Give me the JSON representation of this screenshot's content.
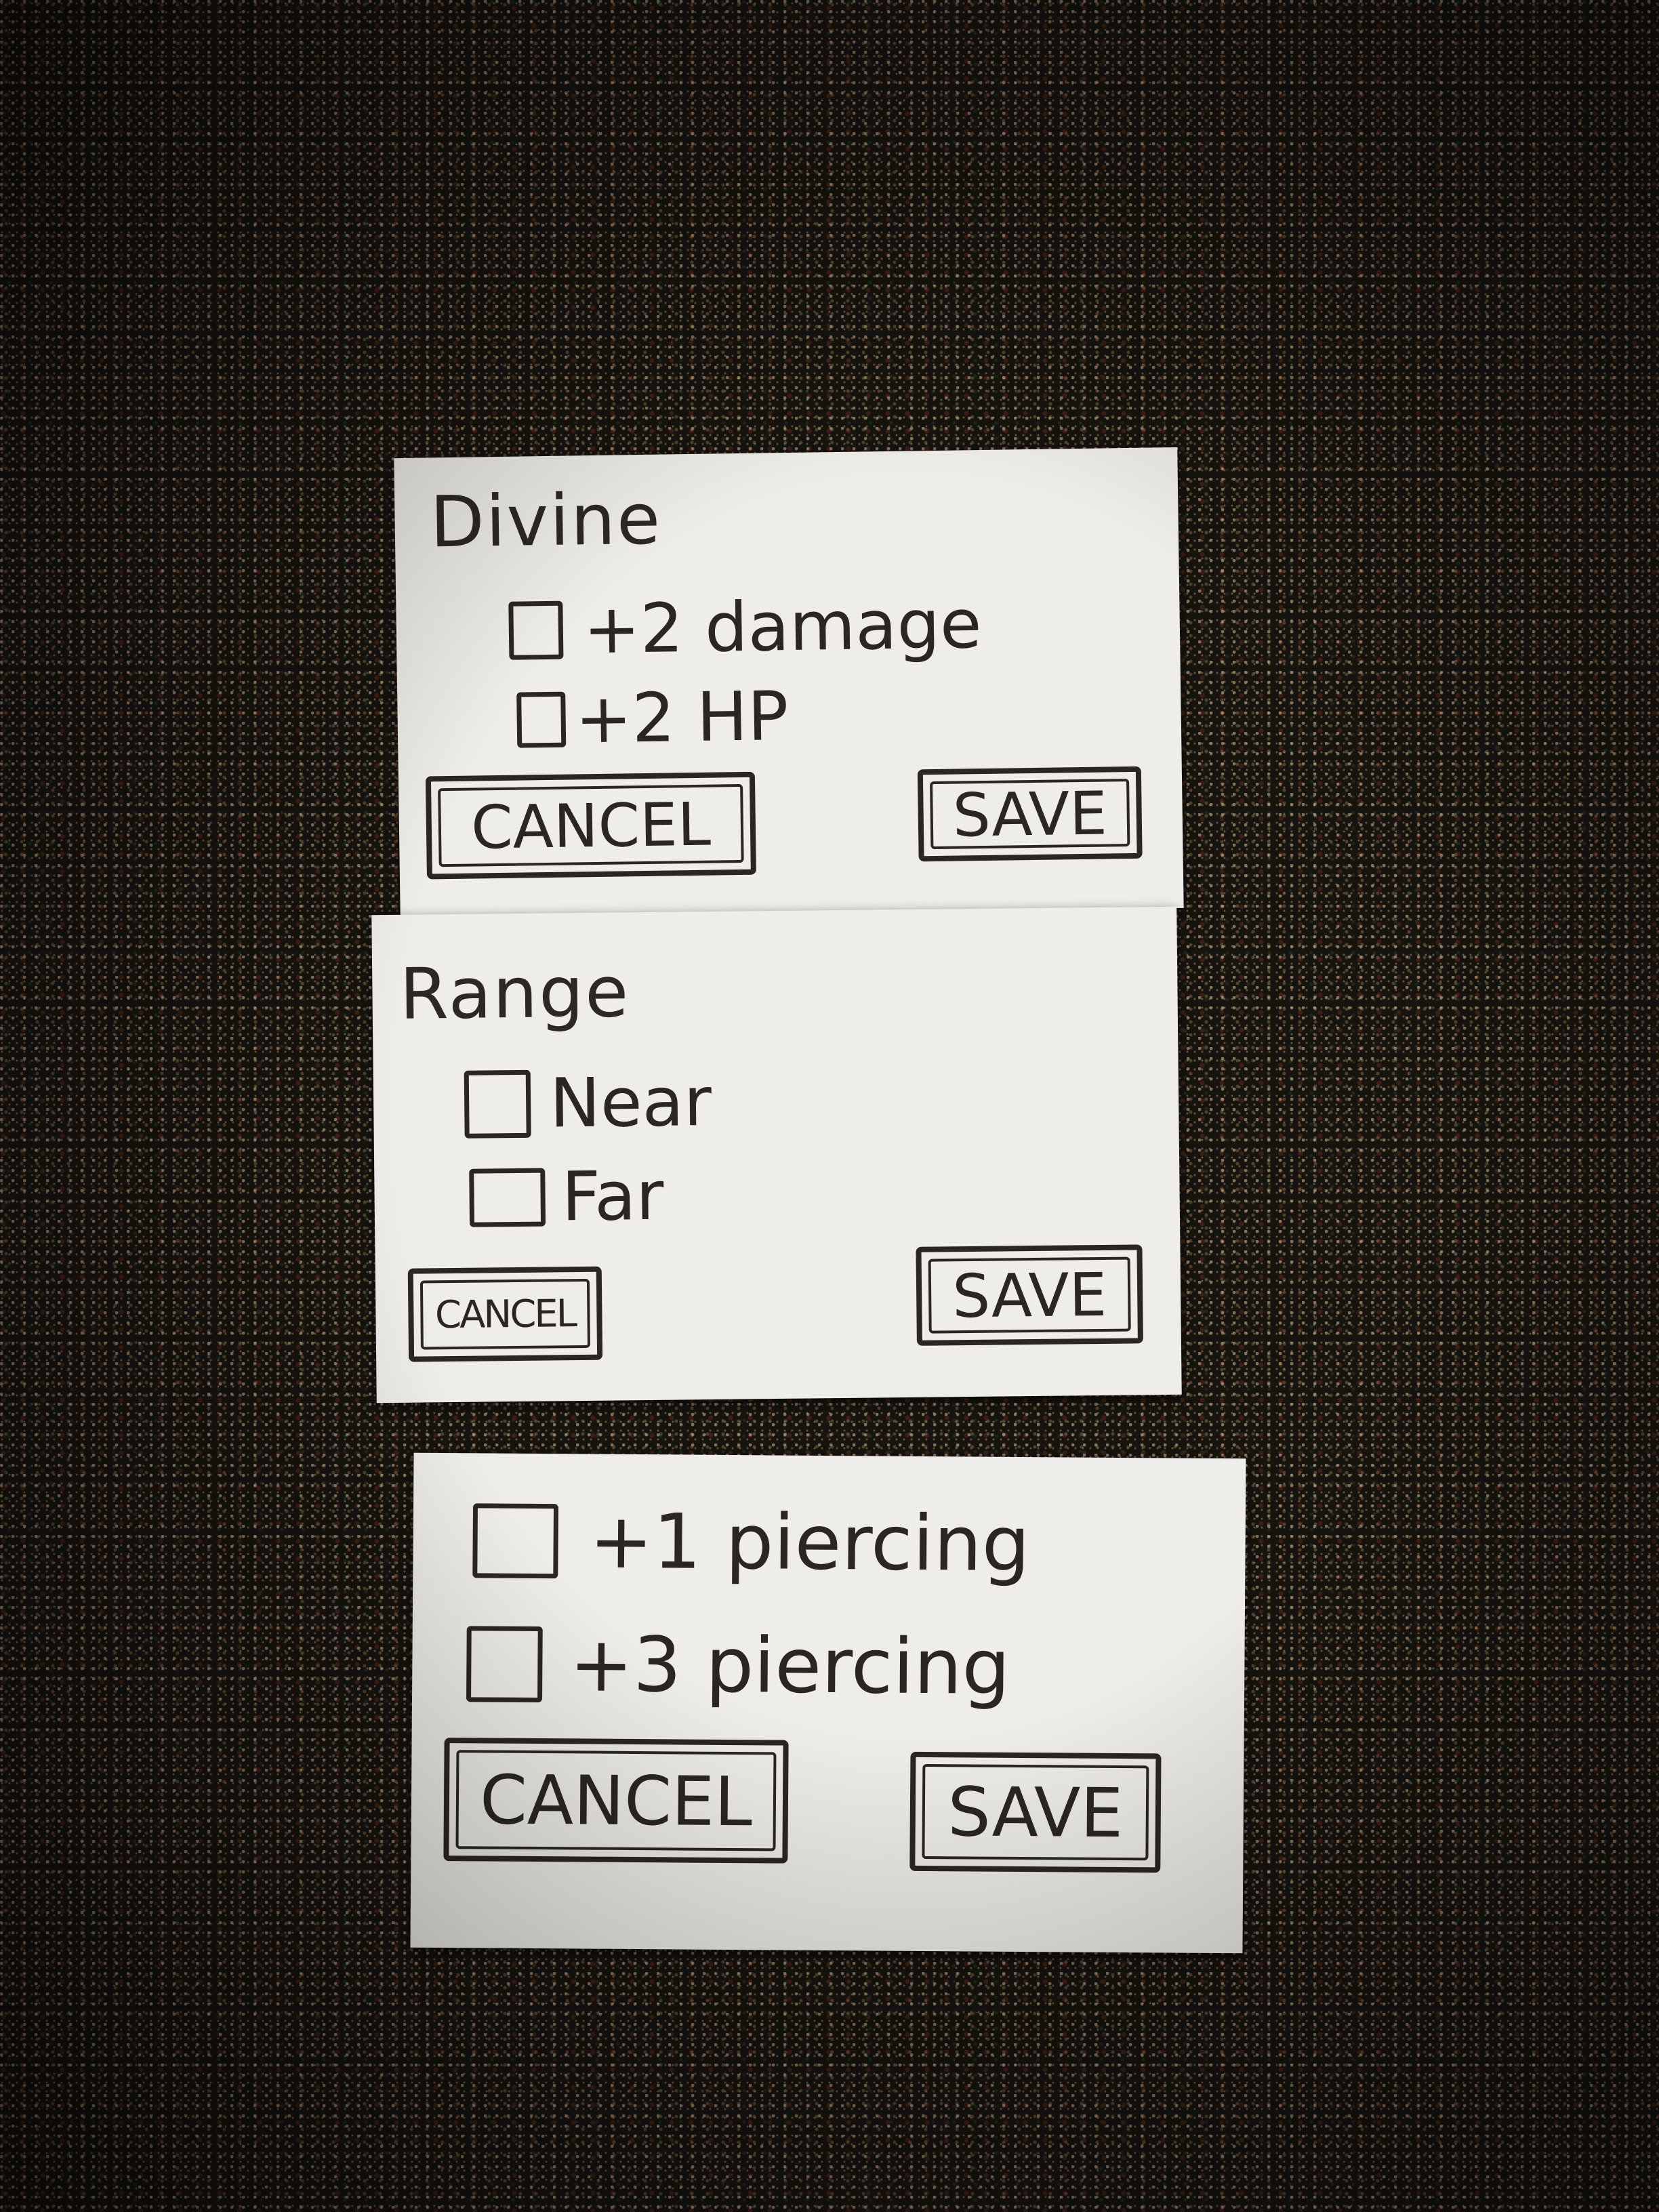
{
  "cards": [
    {
      "title": "Divine",
      "options": [
        "+2 damage",
        "+2 HP"
      ],
      "cancel_label": "CANCEL",
      "save_label": "SAVE"
    },
    {
      "title": "Range",
      "options": [
        "Near",
        "Far"
      ],
      "cancel_label": "CANCEL",
      "save_label": "SAVE"
    },
    {
      "options": [
        "+1 piercing",
        "+3 piercing"
      ],
      "cancel_label": "CANCEL",
      "save_label": "SAVE"
    }
  ]
}
